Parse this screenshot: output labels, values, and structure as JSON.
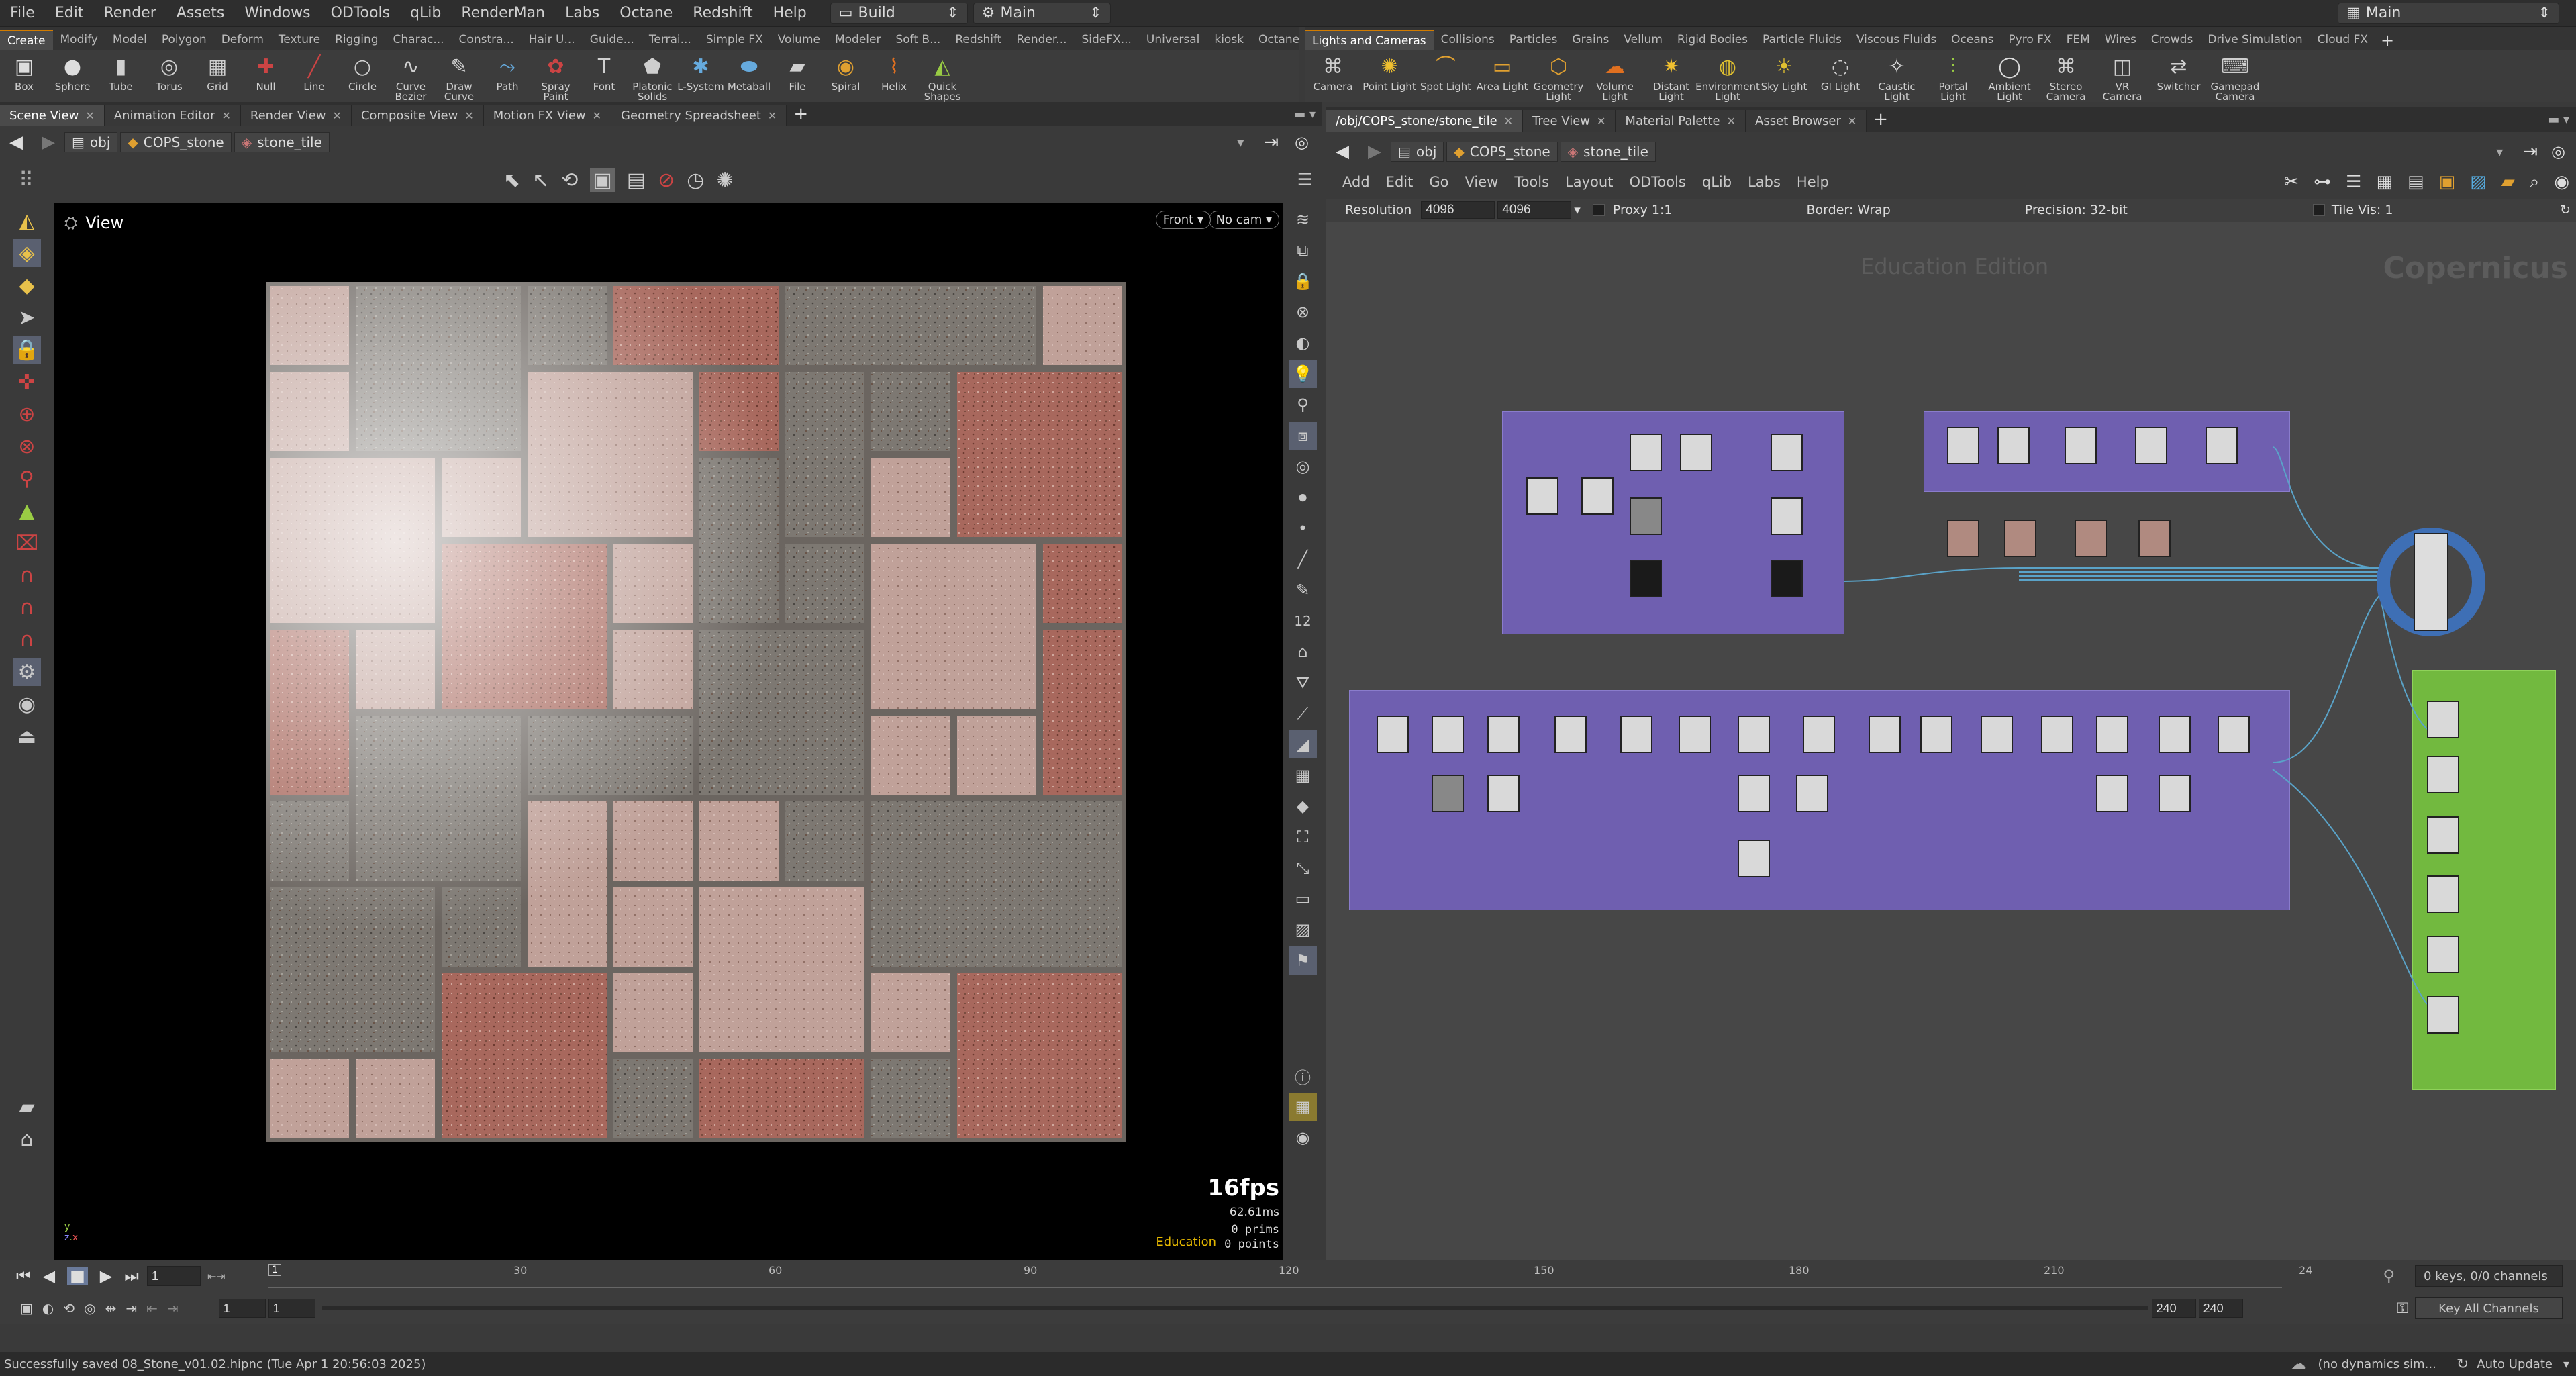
{
  "menu": {
    "items": [
      "File",
      "Edit",
      "Render",
      "Assets",
      "Windows",
      "ODTools",
      "qLib",
      "RenderMan",
      "Labs",
      "Octane",
      "Redshift",
      "Help"
    ],
    "desktop": "Build",
    "workspace": "Main",
    "right_desktop": "Main"
  },
  "shelf_left": {
    "tabs": [
      "Create",
      "Modify",
      "Model",
      "Polygon",
      "Deform",
      "Texture",
      "Rigging",
      "Charac...",
      "Constra...",
      "Hair U...",
      "Guide...",
      "Terrai...",
      "Simple FX",
      "Volume",
      "Modeler",
      "Soft B...",
      "Redshift",
      "Render...",
      "SideFX...",
      "Universal",
      "kiosk",
      "Octane"
    ],
    "tools": [
      {
        "label": "Box",
        "icon": "box-icon"
      },
      {
        "label": "Sphere",
        "icon": "sphere-icon"
      },
      {
        "label": "Tube",
        "icon": "tube-icon"
      },
      {
        "label": "Torus",
        "icon": "torus-icon"
      },
      {
        "label": "Grid",
        "icon": "grid-icon"
      },
      {
        "label": "Null",
        "icon": "null-icon"
      },
      {
        "label": "Line",
        "icon": "line-icon"
      },
      {
        "label": "Circle",
        "icon": "circle-icon"
      },
      {
        "label": "Curve Bezier",
        "icon": "curve-bezier-icon"
      },
      {
        "label": "Draw Curve",
        "icon": "draw-curve-icon"
      },
      {
        "label": "Path",
        "icon": "path-icon"
      },
      {
        "label": "Spray Paint",
        "icon": "spray-paint-icon"
      },
      {
        "label": "Font",
        "icon": "font-icon"
      },
      {
        "label": "Platonic Solids",
        "icon": "platonic-icon"
      },
      {
        "label": "L-System",
        "icon": "lsystem-icon"
      },
      {
        "label": "Metaball",
        "icon": "metaball-icon"
      },
      {
        "label": "File",
        "icon": "file-icon"
      },
      {
        "label": "Spiral",
        "icon": "spiral-icon"
      },
      {
        "label": "Helix",
        "icon": "helix-icon"
      },
      {
        "label": "Quick Shapes",
        "icon": "quick-shapes-icon"
      }
    ]
  },
  "shelf_right": {
    "tabs": [
      "Lights and Cameras",
      "Collisions",
      "Particles",
      "Grains",
      "Vellum",
      "Rigid Bodies",
      "Particle Fluids",
      "Viscous Fluids",
      "Oceans",
      "Pyro FX",
      "FEM",
      "Wires",
      "Crowds",
      "Drive Simulation",
      "Cloud FX"
    ],
    "tools": [
      {
        "label": "Camera",
        "icon": "camera-icon"
      },
      {
        "label": "Point Light",
        "icon": "point-light-icon"
      },
      {
        "label": "Spot Light",
        "icon": "spot-light-icon"
      },
      {
        "label": "Area Light",
        "icon": "area-light-icon"
      },
      {
        "label": "Geometry Light",
        "icon": "geometry-light-icon"
      },
      {
        "label": "Volume Light",
        "icon": "volume-light-icon"
      },
      {
        "label": "Distant Light",
        "icon": "distant-light-icon"
      },
      {
        "label": "Environment Light",
        "icon": "environment-light-icon"
      },
      {
        "label": "Sky Light",
        "icon": "sky-light-icon"
      },
      {
        "label": "GI Light",
        "icon": "gi-light-icon"
      },
      {
        "label": "Caustic Light",
        "icon": "caustic-light-icon"
      },
      {
        "label": "Portal Light",
        "icon": "portal-light-icon"
      },
      {
        "label": "Ambient Light",
        "icon": "ambient-light-icon"
      },
      {
        "label": "Stereo Camera",
        "icon": "stereo-camera-icon"
      },
      {
        "label": "VR Camera",
        "icon": "vr-camera-icon"
      },
      {
        "label": "Switcher",
        "icon": "switcher-icon"
      },
      {
        "label": "Gamepad Camera",
        "icon": "gamepad-camera-icon"
      }
    ]
  },
  "left_panel": {
    "tabs": [
      "Scene View",
      "Animation Editor",
      "Render View",
      "Composite View",
      "Motion FX View",
      "Geometry Spreadsheet"
    ],
    "path": [
      "obj",
      "COPS_stone",
      "stone_tile"
    ],
    "view_label": "View",
    "front_label": "Front",
    "cam_label": "No cam",
    "fps": "16fps",
    "ms": "62.61ms",
    "prims": "0  prims",
    "points": "0 points",
    "edu": "Education"
  },
  "right_panel": {
    "tabs": [
      "/obj/COPS_stone/stone_tile",
      "Tree View",
      "Material Palette",
      "Asset Browser"
    ],
    "path": [
      "obj",
      "COPS_stone",
      "stone_tile"
    ],
    "menus": [
      "Add",
      "Edit",
      "Go",
      "View",
      "Tools",
      "Layout",
      "ODTools",
      "qLib",
      "Labs",
      "Help"
    ],
    "resolution_label": "Resolution",
    "res_x": "4096",
    "res_y": "4096",
    "proxy": "Proxy 1:1",
    "border": "Border: Wrap",
    "precision": "Precision: 32-bit",
    "tilevis": "Tile Vis: 1",
    "watermark": "Education Edition",
    "context": "Copernicus"
  },
  "timeline": {
    "ticks": [
      "30",
      "60",
      "90",
      "120",
      "150",
      "180",
      "210",
      "24"
    ],
    "frame": "1",
    "start": "1",
    "start2": "1",
    "end": "240",
    "end2": "240",
    "keys": "0 keys, 0/0 channels",
    "key_all": "Key All Channels"
  },
  "status": {
    "message": "Successfully saved 08_Stone_v01.02.hipnc (Tue Apr  1 20:56:03 2025)",
    "dyn": "(no dynamics sim...",
    "auto": "Auto Update"
  },
  "colors": {
    "accent": "#d27c00",
    "netbox": "#6f5fb0",
    "greenbox": "#72b93f"
  }
}
